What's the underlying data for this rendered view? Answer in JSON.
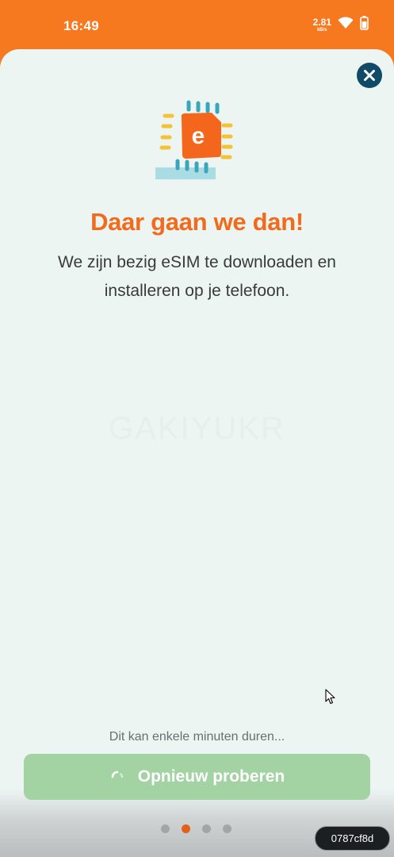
{
  "status_bar": {
    "time": "16:49",
    "net_speed_value": "2.81",
    "net_speed_unit": "kB/s",
    "icons": [
      "wifi-icon",
      "battery-icon"
    ]
  },
  "dialog": {
    "close_icon": "close-icon",
    "illustration": "esim-chip-icon",
    "chip_letter": "e",
    "title": "Daar gaan we dan!",
    "subtitle": "We zijn bezig eSIM te downloaden en installeren op je telefoon.",
    "watermark": "GAKIYUKR",
    "hint": "Dit kan enkele minuten duren...",
    "retry_button": {
      "label": "Opnieuw proberen",
      "icon": "spinner-icon"
    }
  },
  "pager": {
    "total": 4,
    "active_index": 1
  },
  "session_badge": "0787cf8d",
  "colors": {
    "brand_orange": "#f6781f",
    "title_orange": "#f26a1b",
    "sheet_background": "#edf5f3",
    "close_button": "#0f4a66",
    "retry_button_bg": "#a3d3a3",
    "chip_teal": "#3aa6bc",
    "chip_yellow": "#f5c235"
  }
}
